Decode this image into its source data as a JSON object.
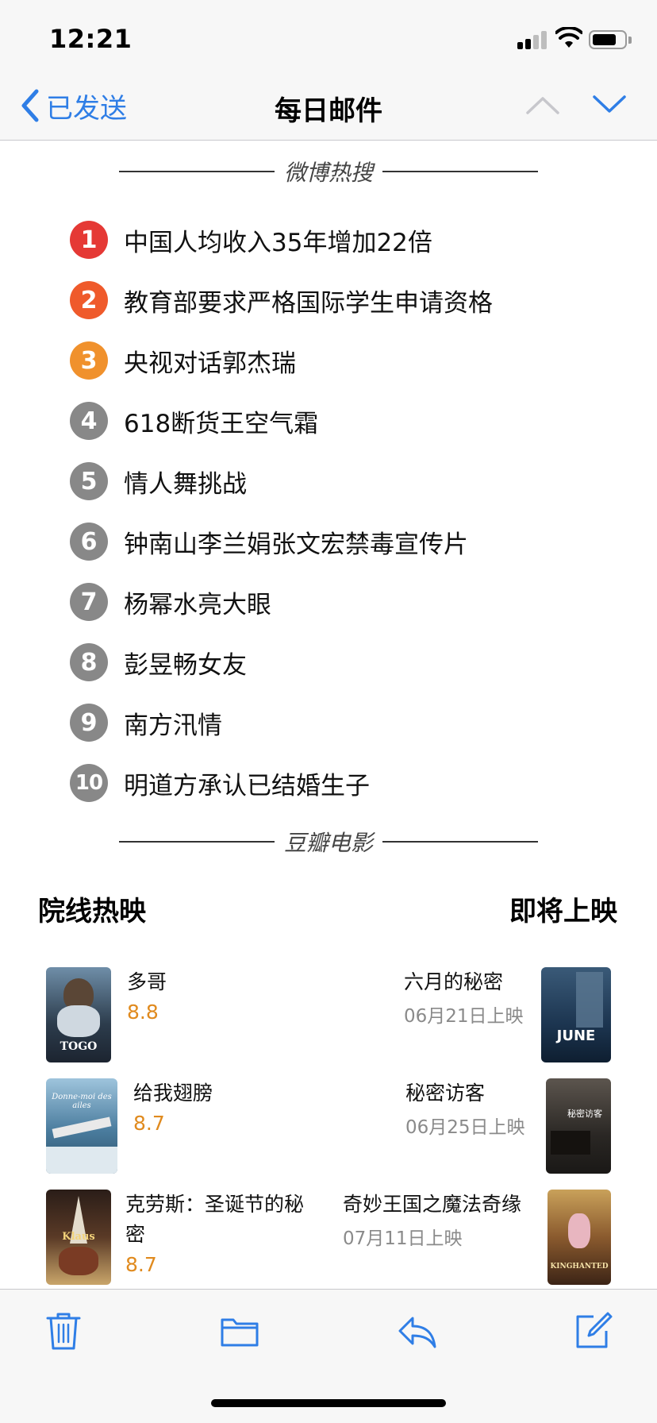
{
  "status": {
    "time": "12:21"
  },
  "nav": {
    "back_label": "已发送",
    "title": "每日邮件"
  },
  "weibo": {
    "header": "微博热搜",
    "items": [
      {
        "rank": "1",
        "text": "中国人均收入35年增加22倍",
        "color": "#e53935"
      },
      {
        "rank": "2",
        "text": "教育部要求严格国际学生申请资格",
        "color": "#ef5a2b"
      },
      {
        "rank": "3",
        "text": "央视对话郭杰瑞",
        "color": "#f0912d"
      },
      {
        "rank": "4",
        "text": "618断货王空气霜",
        "color": "#888888"
      },
      {
        "rank": "5",
        "text": "情人舞挑战",
        "color": "#888888"
      },
      {
        "rank": "6",
        "text": "钟南山李兰娟张文宏禁毒宣传片",
        "color": "#888888"
      },
      {
        "rank": "7",
        "text": "杨幂水亮大眼",
        "color": "#888888"
      },
      {
        "rank": "8",
        "text": "彭昱畅女友",
        "color": "#888888"
      },
      {
        "rank": "9",
        "text": "南方汛情",
        "color": "#888888"
      },
      {
        "rank": "10",
        "text": "明道方承认已结婚生子",
        "color": "#888888"
      }
    ]
  },
  "douban": {
    "header": "豆瓣电影",
    "now_showing_label": "院线热映",
    "coming_soon_label": "即将上映",
    "now_showing": [
      {
        "title": "多哥",
        "rating": "8.8",
        "poster_text": "TOGO"
      },
      {
        "title": "给我翅膀",
        "rating": "8.7",
        "poster_text": "Donne-moi des ailes"
      },
      {
        "title": "克劳斯：圣诞节的秘密",
        "title_line1": "克劳斯：圣诞节的秘",
        "title_line2": "密",
        "rating": "8.7",
        "poster_text": "Klaus"
      }
    ],
    "coming_soon": [
      {
        "title": "六月的秘密",
        "date": "06月21日上映",
        "poster_text": "JUNE"
      },
      {
        "title": "秘密访客",
        "date": "06月25日上映",
        "poster_text": "秘密访客"
      },
      {
        "title": "奇妙王国之魔法奇缘",
        "date": "07月11日上映",
        "poster_text": "KINGHANTED"
      }
    ]
  },
  "colors": {
    "accent": "#2f7ee6",
    "rating": "#e08a1e"
  }
}
